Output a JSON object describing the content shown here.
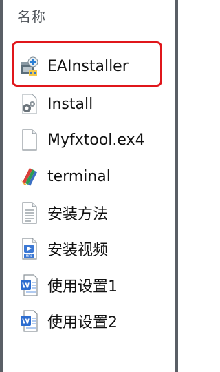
{
  "header": {
    "column_title": "名称"
  },
  "files": [
    {
      "name": "EAInstaller",
      "icon": "installer-icon"
    },
    {
      "name": "Install",
      "icon": "settings-file-icon"
    },
    {
      "name": "Myfxtool.ex4",
      "icon": "blank-file-icon"
    },
    {
      "name": "terminal",
      "icon": "terminal-app-icon"
    },
    {
      "name": "安装方法",
      "icon": "text-document-icon"
    },
    {
      "name": "安装视频",
      "icon": "video-file-icon"
    },
    {
      "name": "使用设置1",
      "icon": "word-document-icon"
    },
    {
      "name": "使用设置2",
      "icon": "word-document-icon"
    }
  ],
  "highlight": {
    "target": "EAInstaller",
    "color": "#e0161b"
  },
  "colors": {
    "frame_border": "#5a5f66",
    "text": "#111111",
    "header_text": "#4a4f55"
  }
}
